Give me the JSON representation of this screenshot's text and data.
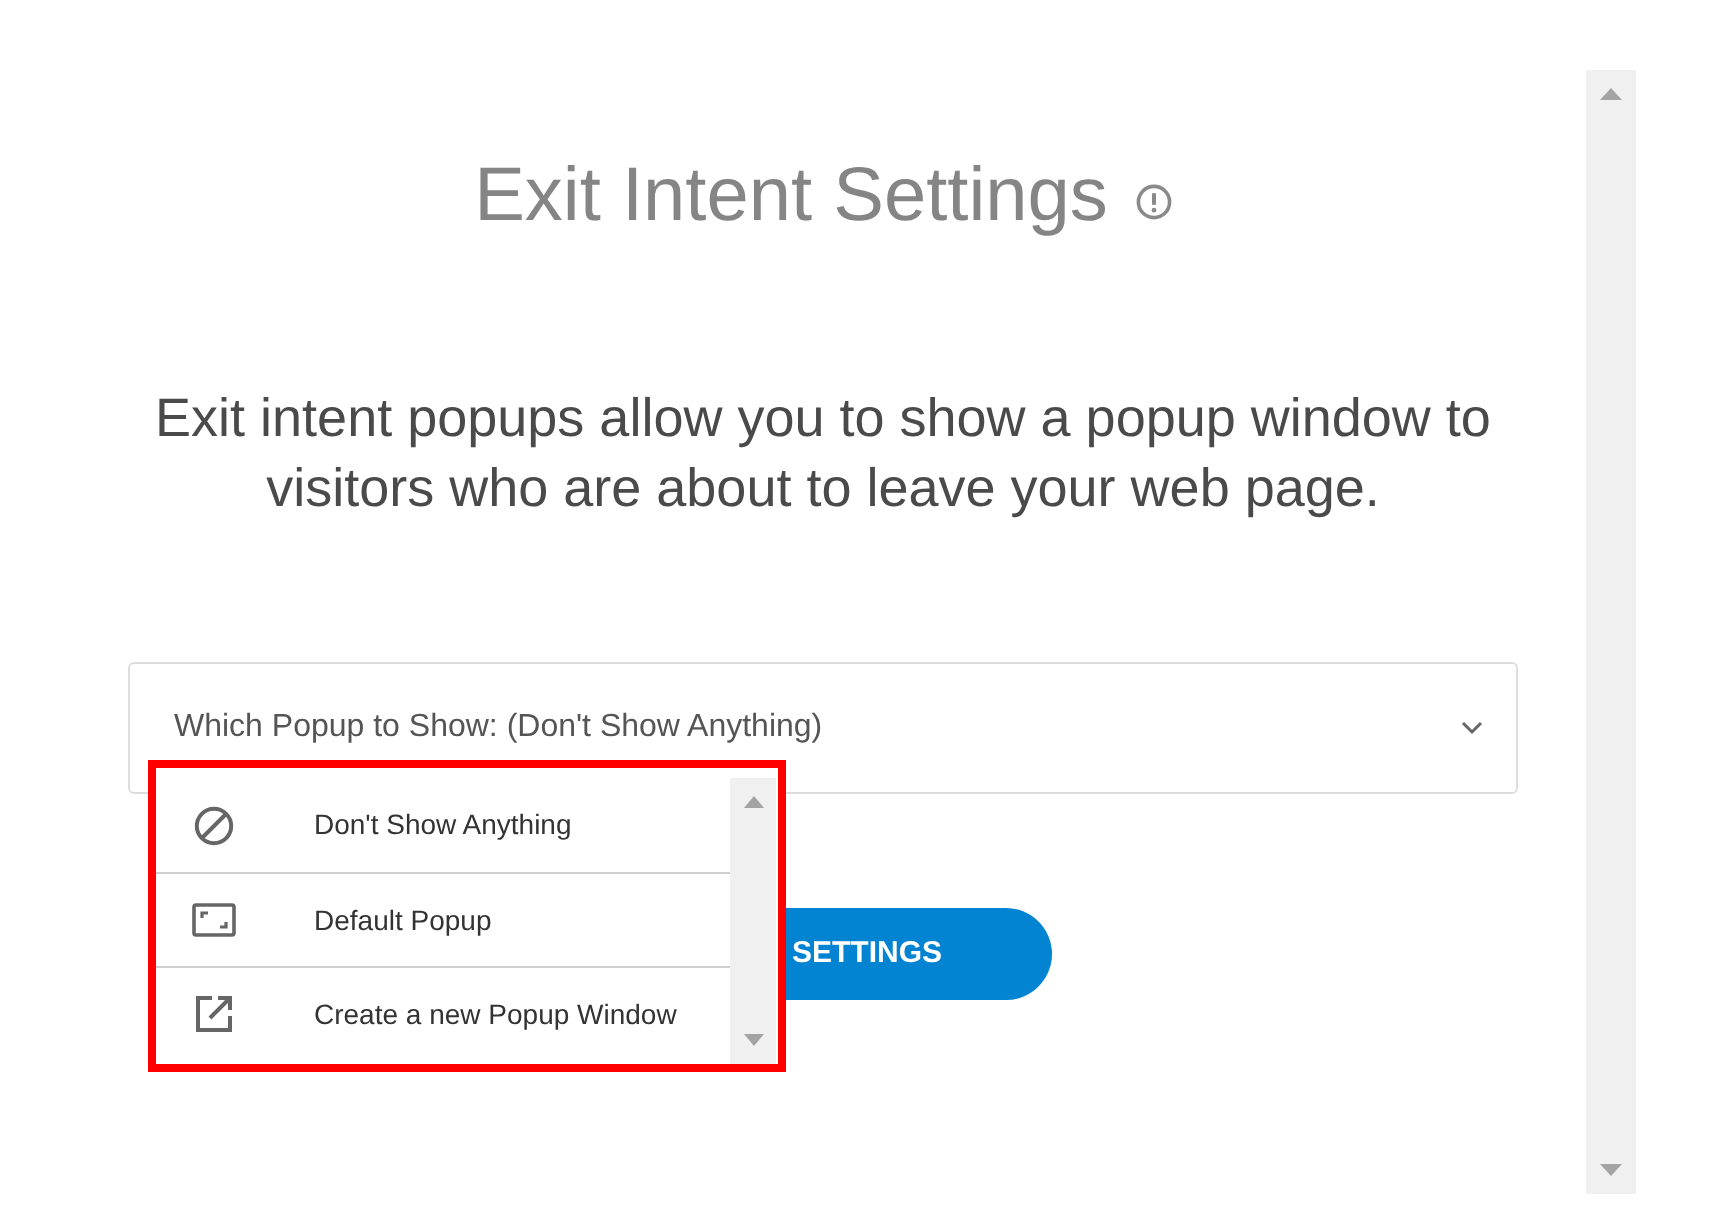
{
  "title": "Exit Intent Settings",
  "description": "Exit intent popups allow you to show a popup window to visitors who are about to leave your web page.",
  "popup_select": {
    "label": "Which Popup to Show: (Don't Show Anything)",
    "expanded": true
  },
  "dropdown": {
    "highlighted": true,
    "options": [
      {
        "kind": "none",
        "label": "Don't Show Anything",
        "selected": false
      },
      {
        "kind": "existing",
        "label": "Default Popup",
        "selected": false
      },
      {
        "kind": "create",
        "label": "Create a new Popup Window",
        "selected": false
      }
    ]
  },
  "button": {
    "label": "SETTINGS"
  }
}
